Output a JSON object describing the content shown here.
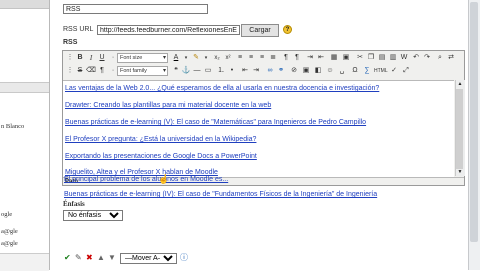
{
  "left_panel": {
    "items": [
      "n Blanco",
      "ogle",
      "a@gle",
      "a@gle"
    ]
  },
  "form": {
    "title_value": "RSS",
    "rss_url_label": "RSS URL",
    "rss_url_value": "http://feeds.feedburner.com/ReflexionesEnE",
    "load_button": "Cargar",
    "help_icon_text": "?",
    "editor_label": "RSS"
  },
  "toolbar": {
    "font_size": "Font size",
    "font_family": "Font family"
  },
  "editor": {
    "links": [
      "Las ventajas de la Web 2.0... ¿Qué esperamos de ella al usarla en nuestra docencia e investigación?",
      "Drawter: Creando las plantillas para mi material docente en la web",
      "Buenas prácticas de e-learning (V): El caso de \"Matemáticas\" para Ingenieros de Pedro Campillo",
      "El Profesor X pregunta: ¿Está la universidad en la Wikipedia?",
      "Exportando las presentaciones de Google Docs a PowerPoint",
      "Miguelito, Altea y el Profesor X hablan de Moodle",
      "El principal problema de los alumnos en Moodle es...",
      "Buenas prácticas de e-learning (IV): El caso de \"Fundamentos Físicos de la Ingeniería\" de Ingeniería"
    ],
    "path_label": "Path:"
  },
  "emphasis": {
    "label": "Énfasis",
    "selected": "No énfasis"
  },
  "move": {
    "selected": "—Mover A—"
  }
}
